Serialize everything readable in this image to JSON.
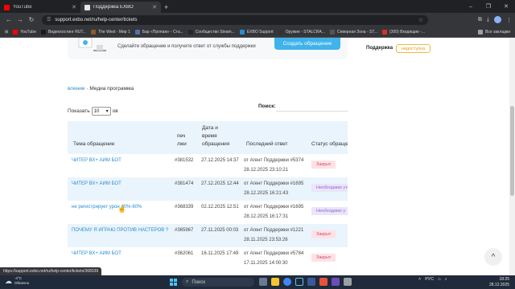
{
  "browser": {
    "tabs": [
      {
        "title": "YouTube",
        "color": "#ff0000",
        "active": false
      },
      {
        "title": "Поддержка EXBO",
        "color": "#e6e6e6",
        "active": true
      }
    ],
    "new_tab_glyph": "+",
    "window_controls": [
      "–",
      "❐",
      "✕"
    ],
    "url": "support.exbo.net/ru/help-center/tickets",
    "bookmarks": [
      {
        "label": "YouTube",
        "color": "#ff0000"
      },
      {
        "label": "Видеохостинг RUT...",
        "color": "#1a1a1a"
      },
      {
        "label": "The West - Мир 1",
        "color": "#8b5a2b"
      },
      {
        "label": "Бар «Пропаж» - Ста...",
        "color": "#4a76a8"
      },
      {
        "label": "Сообщество Steam...",
        "color": "#1b2838"
      },
      {
        "label": "EXBO Support",
        "color": "#2a8dd1"
      },
      {
        "label": "Оружие - STALCRA...",
        "color": "#333333"
      },
      {
        "label": "Северная Зона - ST...",
        "color": "#555555"
      },
      {
        "label": "(300) Входящие -...",
        "color": "#d93025"
      }
    ],
    "all_bookmarks": "Все закладки",
    "status_url": "https://support.exbo.net/ru/help-center/tickets/368339"
  },
  "page": {
    "banner_text": "Сделайте обращение и получите ответ от службы поддержки",
    "banner_button": "Создать обращение",
    "side_label": "Поддержка",
    "side_badge": "недоступна",
    "breadcrumb_link": "вление",
    "breadcrumb_current": "Медиа программа",
    "show_prefix": "Показать",
    "show_value": "10",
    "show_suffix": "ов",
    "search_label": "Поиск:",
    "headers": {
      "subject": "Тема обращение",
      "id": [
        "печ",
        "лжи"
      ],
      "date": [
        "Дата и",
        "время",
        "обращения"
      ],
      "answer": "Последний ответ",
      "status": "Статус обраще"
    },
    "rows": [
      {
        "subject": "ЧИТЕР ВХ+ АИМ БОТ",
        "id": "#381532",
        "date": "27.12.2025 14:37",
        "answer": "от Агент Поддержки #5374",
        "answer_date": "28.12.2025 23:10:21",
        "status": "Закрыт",
        "kind": "closed"
      },
      {
        "subject": "ЧИТЕР ВХ+ АИМ БОТ",
        "id": "#381474",
        "date": "27.12.2025 12:44",
        "answer": "от Агент Поддержки #1695",
        "answer_date": "28.12.2025 16:21:43",
        "status": "Необходимо уто",
        "kind": "need"
      },
      {
        "subject": "не регистрирует урон 40%-60%",
        "id": "#368339",
        "date": "02.12.2025 12:51",
        "answer": "от Агент Поддержки #1695",
        "answer_date": "28.12.2025 16:17:31",
        "status": "Необходимо у",
        "kind": "need"
      },
      {
        "subject": "ПОЧЕМУ Я ИГРАЮ ПРОТИВ НАСТЕРОВ ?",
        "id": "#365967",
        "date": "27.11.2025 00:03",
        "answer": "от Агент Поддержки #1221",
        "answer_date": "28.11.2025 23:53:26",
        "status": "Закрыт",
        "kind": "closed"
      },
      {
        "subject": "ЧИТЕР ВХ+ АИМ БОТ",
        "id": "#362061",
        "date": "16.11.2025 17:49",
        "answer": "от Агент Поддержки #5784",
        "answer_date": "17.11.2025 14:00:30",
        "status": "Закрыт",
        "kind": "closed"
      }
    ],
    "to_top_glyph": "^"
  },
  "taskbar": {
    "temperature": "-4°C",
    "weather": "Облачно",
    "search": "Поиск",
    "lang": "РУС",
    "time": "18:25",
    "date": "28.12.2025"
  }
}
